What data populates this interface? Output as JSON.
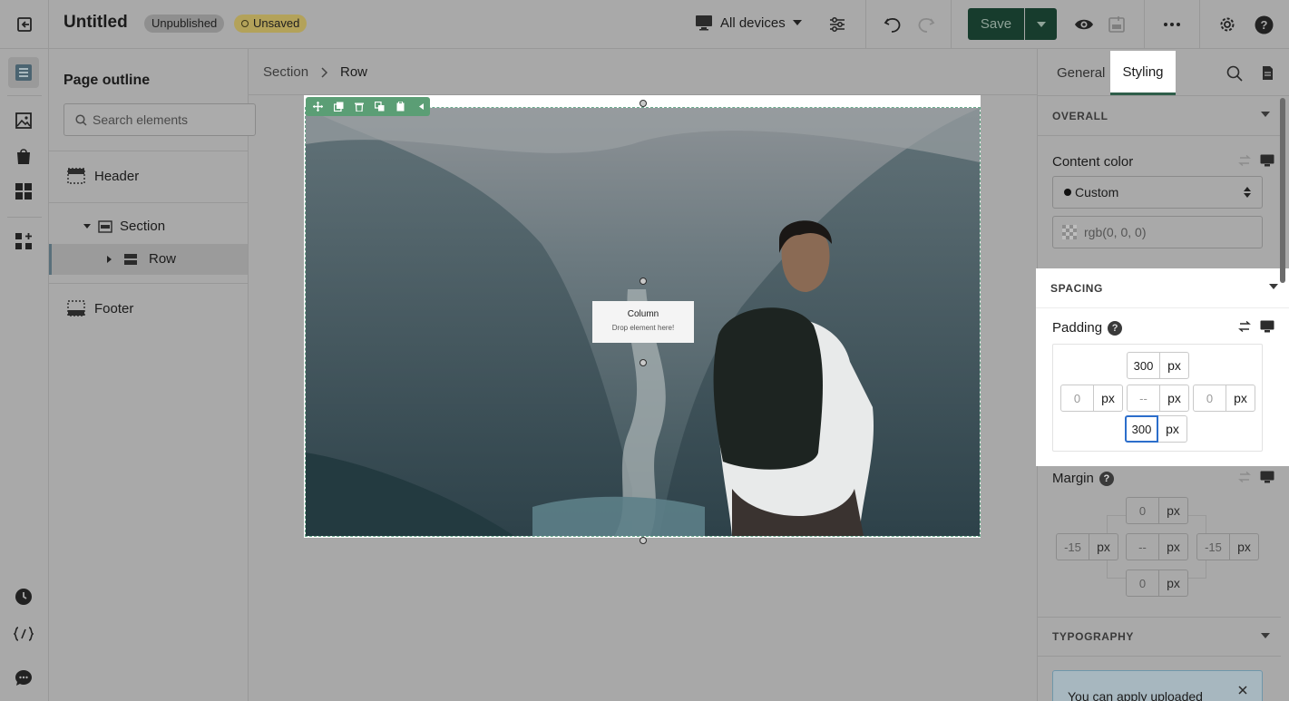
{
  "app": {
    "title": "Untitled",
    "badge_unpublished": "Unpublished",
    "badge_unsaved": "Unsaved",
    "device_selector": "All devices",
    "save_label": "Save"
  },
  "outline": {
    "title": "Page outline",
    "search_placeholder": "Search elements",
    "items": [
      {
        "label": "Header"
      },
      {
        "label": "Section"
      },
      {
        "label": "Row"
      },
      {
        "label": "Footer"
      }
    ]
  },
  "canvas": {
    "breadcrumb": [
      "Section",
      "Row"
    ],
    "column_title": "Column",
    "column_hint": "Drop element here!"
  },
  "inspector": {
    "tabs": [
      "General",
      "Styling"
    ],
    "active_tab": "Styling",
    "overall": {
      "heading": "OVERALL",
      "content_color_label": "Content color",
      "content_color_mode": "Custom",
      "content_color_value": "rgb(0, 0, 0)"
    },
    "spacing": {
      "heading": "SPACING",
      "padding_label": "Padding",
      "padding": {
        "top": "300",
        "right": "0",
        "bottom": "300",
        "left": "0",
        "center": "--",
        "unit": "px"
      },
      "margin_label": "Margin",
      "margin": {
        "top": "0",
        "right": "-15",
        "bottom": "0",
        "left": "-15",
        "center": "--",
        "unit": "px"
      }
    },
    "typography": {
      "heading": "TYPOGRAPHY"
    },
    "notice": "You can apply uploaded"
  },
  "colors": {
    "save_bg": "#173c2d",
    "toolbar_green": "#5b9e75",
    "selection_dash": "#6aaa8c",
    "focus_blue": "#2c6ecb"
  }
}
